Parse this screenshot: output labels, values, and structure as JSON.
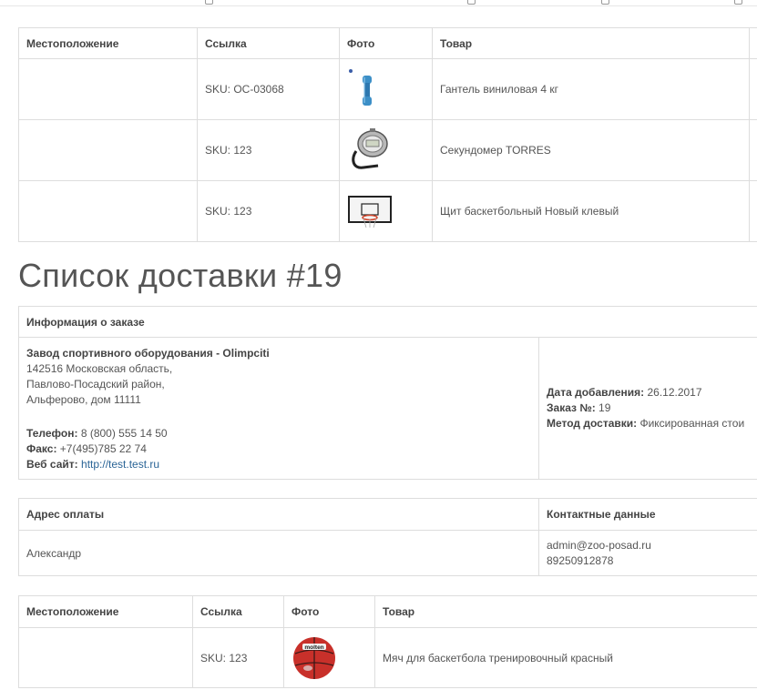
{
  "colors": {
    "border": "#dddddd",
    "link": "#2a6496",
    "text": "#555555",
    "heading": "#555555"
  },
  "first_products": {
    "headers": [
      "Местоположение",
      "Ссылка",
      "Фото",
      "Товар"
    ],
    "rows": [
      {
        "location": "",
        "sku": "SKU: OC-03068",
        "photo": "dumbbell-image",
        "name": "Гантель виниловая 4 кг"
      },
      {
        "location": "",
        "sku": "SKU: 123",
        "photo": "stopwatch-image",
        "name": "Секундомер TORRES"
      },
      {
        "location": "",
        "sku": "SKU: 123",
        "photo": "basketball-backboard-image",
        "name": "Щит баскетбольный Новый клевый"
      }
    ]
  },
  "delivery": {
    "title": "Список доставки #19",
    "order_info_header": "Информация о заказе",
    "company": {
      "name": "Завод спортивного оборудования - Olimpciti",
      "address_lines": [
        "142516 Московская область,",
        "Павлово-Посадский район,",
        "Альферово, дом 11111"
      ],
      "phone_label": "Телефон:",
      "phone": "8 (800) 555 14 50",
      "fax_label": "Факс:",
      "fax": "+7(495)785 22 74",
      "site_label": "Веб сайт:",
      "site": "http://test.test.ru"
    },
    "order": {
      "date_label": "Дата добавления:",
      "date": "26.12.2017",
      "number_label": "Заказ №:",
      "number": "19",
      "shipping_label": "Метод доставки:",
      "shipping": "Фиксированная стои"
    },
    "payment_header": "Адрес оплаты",
    "contact_header": "Контактные данные",
    "payment_name": "Александр",
    "contact_email": "admin@zoo-posad.ru",
    "contact_phone": "89250912878"
  },
  "second_products": {
    "headers": [
      "Местоположение",
      "Ссылка",
      "Фото",
      "Товар"
    ],
    "rows": [
      {
        "location": "",
        "sku": "SKU: 123",
        "photo": "basketball-image",
        "name": "Мяч для баскетбола тренировочный красный",
        "brand_text": "molten"
      }
    ]
  }
}
